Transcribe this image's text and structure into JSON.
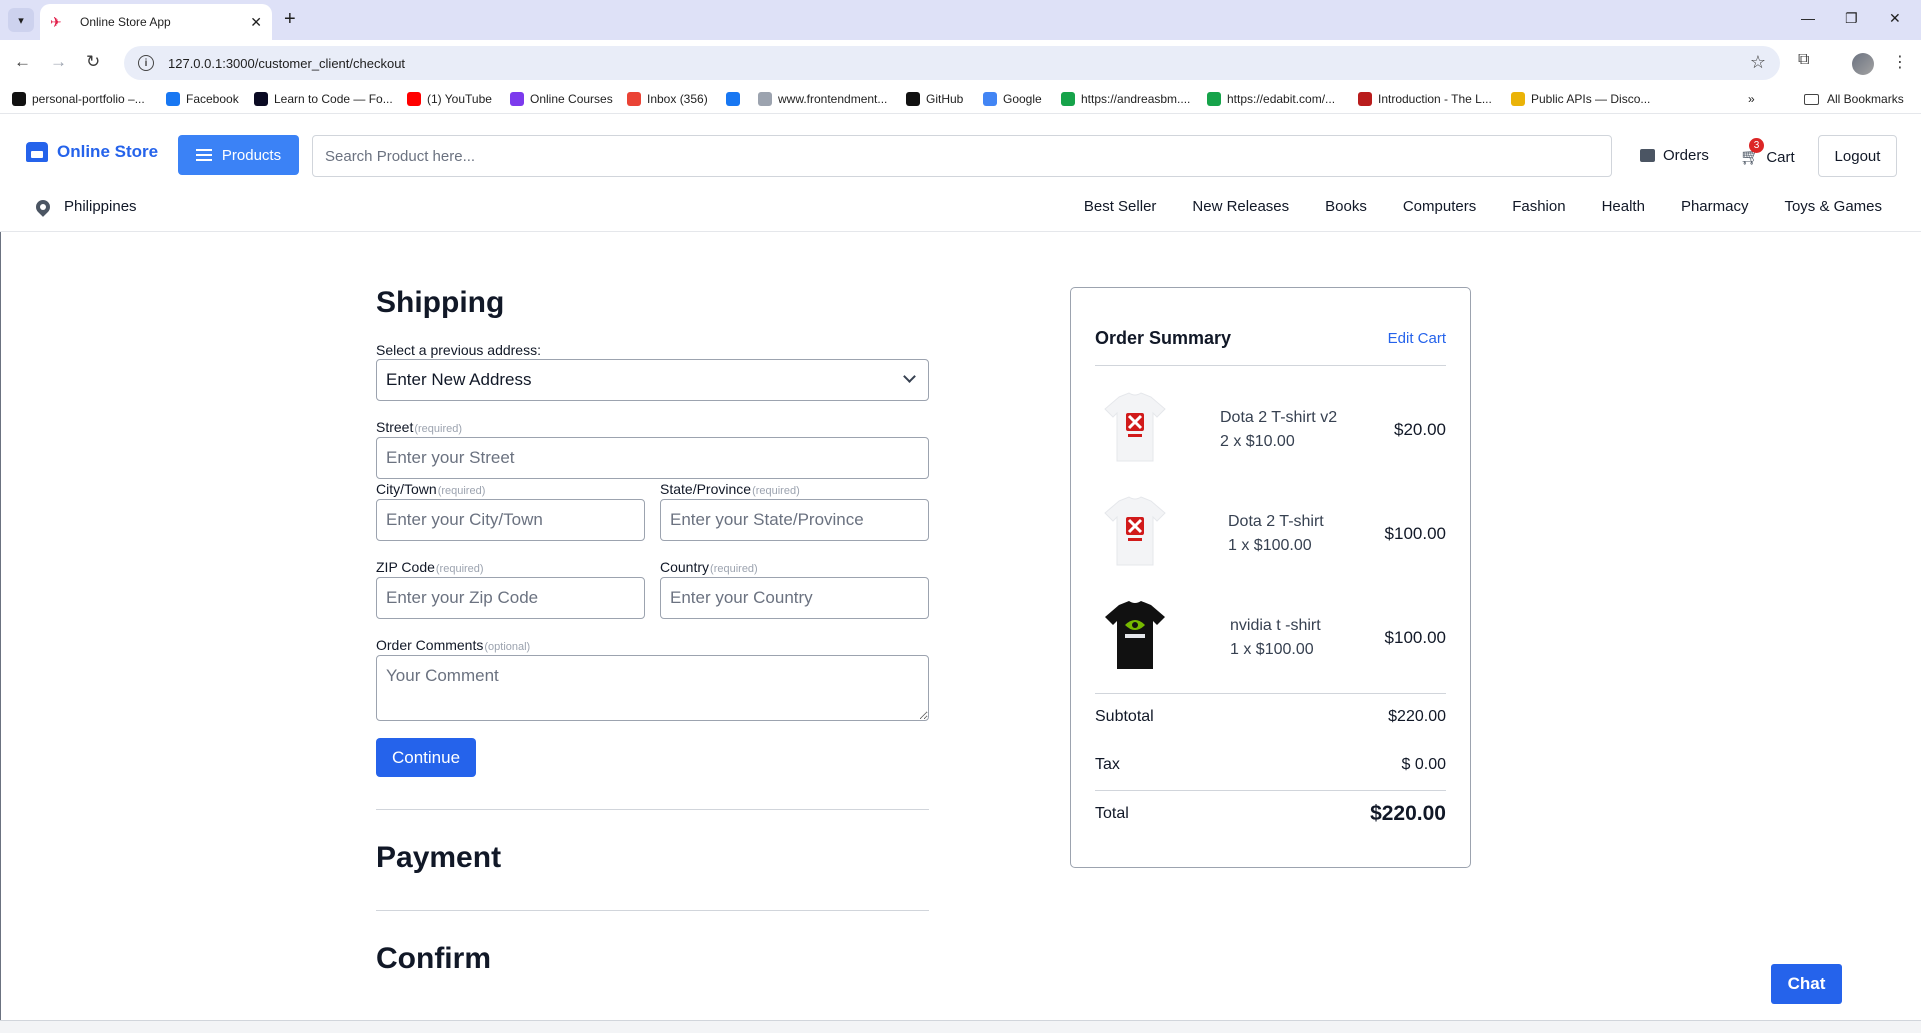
{
  "browser": {
    "tab_title": "Online Store App",
    "url": "127.0.0.1:3000/customer_client/checkout",
    "bookmarks": [
      {
        "label": "personal-portfolio –...",
        "icon": "triangle-icon",
        "color": "#111111"
      },
      {
        "label": "Facebook",
        "icon": "facebook-icon",
        "color": "#1877f2"
      },
      {
        "label": "Learn to Code — Fo...",
        "icon": "freecodecamp-icon",
        "color": "#0a0a23"
      },
      {
        "label": "(1) YouTube",
        "icon": "youtube-icon",
        "color": "#ff0000"
      },
      {
        "label": "Online Courses",
        "icon": "courses-icon",
        "color": "#7c3aed"
      },
      {
        "label": "Inbox (356)",
        "icon": "gmail-icon",
        "color": "#ea4335"
      },
      {
        "label": "",
        "icon": "facebook-icon",
        "color": "#1877f2"
      },
      {
        "label": "www.frontendment...",
        "icon": "frontendmentor-icon",
        "color": "#9ca3af"
      },
      {
        "label": "GitHub",
        "icon": "github-icon",
        "color": "#111111"
      },
      {
        "label": "Google",
        "icon": "google-icon",
        "color": "#4285f4"
      },
      {
        "label": "https://andreasbm....",
        "icon": "cloud-icon",
        "color": "#16a34a"
      },
      {
        "label": "https://edabit.com/...",
        "icon": "edabit-icon",
        "color": "#16a34a"
      },
      {
        "label": "Introduction - The L...",
        "icon": "rust-icon",
        "color": "#b91c1c"
      },
      {
        "label": "Public APIs — Disco...",
        "icon": "bolt-icon",
        "color": "#eab308"
      }
    ],
    "all_bookmarks": "All Bookmarks"
  },
  "header": {
    "brand": "Online Store",
    "products_label": "Products",
    "search_placeholder": "Search Product here...",
    "orders_label": "Orders",
    "cart_label": "Cart",
    "cart_count": "3",
    "logout_label": "Logout",
    "location": "Philippines",
    "categories": [
      "Best Seller",
      "New Releases",
      "Books",
      "Computers",
      "Fashion",
      "Health",
      "Pharmacy",
      "Toys & Games"
    ]
  },
  "shipping": {
    "title": "Shipping",
    "select_label": "Select a previous address:",
    "select_value": "Enter New Address",
    "street_label": "Street",
    "street_placeholder": "Enter your Street",
    "city_label": "City/Town",
    "city_placeholder": "Enter your City/Town",
    "state_label": "State/Province",
    "state_placeholder": "Enter your State/Province",
    "zip_label": "ZIP Code",
    "zip_placeholder": "Enter your Zip Code",
    "country_label": "Country",
    "country_placeholder": "Enter your Country",
    "comments_label": "Order Comments",
    "comments_placeholder": "Your Comment",
    "required_tag": "(required)",
    "optional_tag": "(optional)",
    "continue_label": "Continue"
  },
  "payment": {
    "title": "Payment"
  },
  "confirm": {
    "title": "Confirm"
  },
  "summary": {
    "title": "Order Summary",
    "edit_cart": "Edit Cart",
    "items": [
      {
        "name": "Dota 2 T-shirt v2",
        "qty_line": "2 x $10.00",
        "total": "$20.00",
        "shirt_color": "#f3f4f6"
      },
      {
        "name": "Dota 2 T-shirt",
        "qty_line": "1 x $100.00",
        "total": "$100.00",
        "shirt_color": "#f3f4f6"
      },
      {
        "name": "nvidia t -shirt",
        "qty_line": "1 x $100.00",
        "total": "$100.00",
        "shirt_color": "#111111"
      }
    ],
    "subtotal_label": "Subtotal",
    "subtotal_value": "$220.00",
    "tax_label": "Tax",
    "tax_value": "$ 0.00",
    "total_label": "Total",
    "total_value": "$220.00"
  },
  "chat_label": "Chat"
}
